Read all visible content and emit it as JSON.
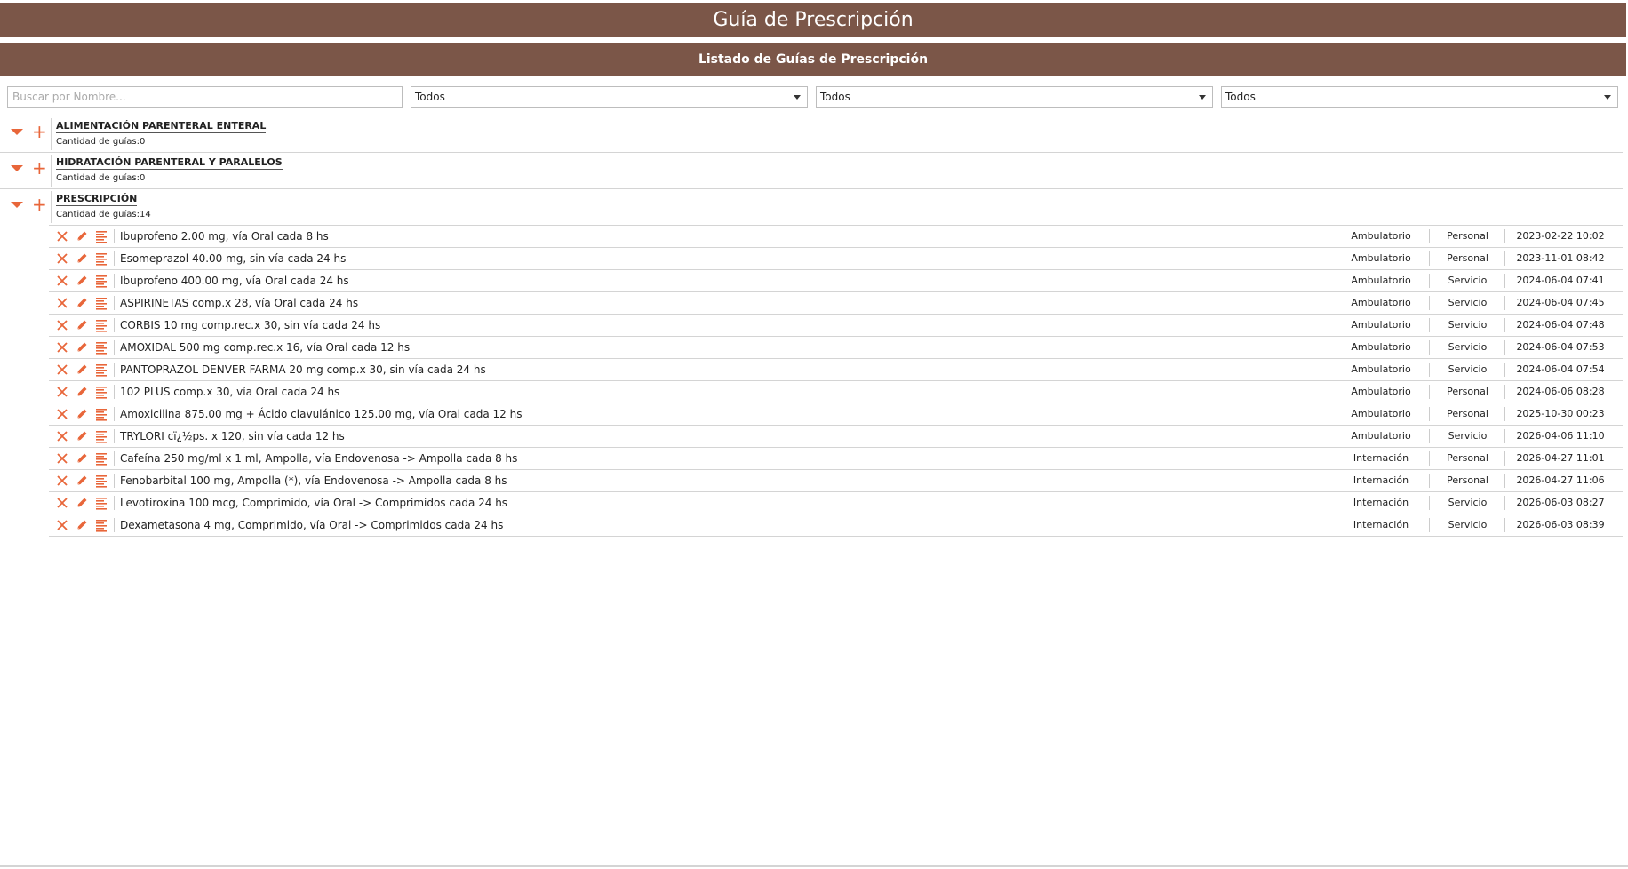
{
  "app": {
    "title": "Guía de Prescripción",
    "subtitle": "Listado de Guías de Prescripción"
  },
  "filters": {
    "search_placeholder": "Buscar por Nombre...",
    "select1": "Todos",
    "select2": "Todos",
    "select3": "Todos"
  },
  "groups": [
    {
      "name": "ALIMENTACIÓN PARENTERAL ENTERAL",
      "count": "Cantidad de guías:0"
    },
    {
      "name": "HIDRATACIÓN PARENTERAL Y PARALELOS",
      "count": "Cantidad de guías:0"
    },
    {
      "name": "PRESCRIPCIÓN",
      "count": "Cantidad de guías:14"
    }
  ],
  "rows": [
    {
      "text": "Ibuprofeno 2.00 mg, vía Oral cada 8 hs",
      "type": "Ambulatorio",
      "owner": "Personal",
      "date": "2023-02-22 10:02"
    },
    {
      "text": "Esomeprazol 40.00 mg, sin vía cada 24 hs",
      "type": "Ambulatorio",
      "owner": "Personal",
      "date": "2023-11-01 08:42"
    },
    {
      "text": "Ibuprofeno 400.00 mg, vía Oral cada 24 hs",
      "type": "Ambulatorio",
      "owner": "Servicio",
      "date": "2024-06-04 07:41"
    },
    {
      "text": "ASPIRINETAS comp.x 28, vía Oral cada 24 hs",
      "type": "Ambulatorio",
      "owner": "Servicio",
      "date": "2024-06-04 07:45"
    },
    {
      "text": "CORBIS 10 mg comp.rec.x 30, sin vía cada 24 hs",
      "type": "Ambulatorio",
      "owner": "Servicio",
      "date": "2024-06-04 07:48"
    },
    {
      "text": "AMOXIDAL 500 mg comp.rec.x 16, vía Oral cada 12 hs",
      "type": "Ambulatorio",
      "owner": "Servicio",
      "date": "2024-06-04 07:53"
    },
    {
      "text": "PANTOPRAZOL DENVER FARMA 20 mg comp.x 30, sin vía cada 24 hs",
      "type": "Ambulatorio",
      "owner": "Servicio",
      "date": "2024-06-04 07:54"
    },
    {
      "text": "102 PLUS comp.x 30, vía Oral cada 24 hs",
      "type": "Ambulatorio",
      "owner": "Personal",
      "date": "2024-06-06 08:28"
    },
    {
      "text": "Amoxicilina 875.00 mg + Ácido clavulánico 125.00 mg, vía Oral cada 12 hs",
      "type": "Ambulatorio",
      "owner": "Personal",
      "date": "2025-10-30 00:23"
    },
    {
      "text": "TRYLORI cï¿½ps. x 120, sin vía cada 12 hs",
      "type": "Ambulatorio",
      "owner": "Servicio",
      "date": "2026-04-06 11:10"
    },
    {
      "text": "Cafeína 250 mg/ml x 1 ml, Ampolla, vía Endovenosa -> Ampolla cada 8 hs",
      "type": "Internación",
      "owner": "Personal",
      "date": "2026-04-27 11:01"
    },
    {
      "text": "Fenobarbital 100 mg, Ampolla (*), vía Endovenosa -> Ampolla cada 8 hs",
      "type": "Internación",
      "owner": "Personal",
      "date": "2026-04-27 11:06"
    },
    {
      "text": "Levotiroxina 100 mcg, Comprimido, vía Oral -> Comprimidos cada 24 hs",
      "type": "Internación",
      "owner": "Servicio",
      "date": "2026-06-03 08:27"
    },
    {
      "text": "Dexametasona 4 mg, Comprimido, vía Oral -> Comprimidos cada 24 hs",
      "type": "Internación",
      "owner": "Servicio",
      "date": "2026-06-03 08:39"
    }
  ],
  "colors": {
    "header_bg": "#7b5648",
    "accent": "#e8663a"
  },
  "icons": {
    "collapse": "caret-down-icon",
    "add": "plus-icon",
    "delete": "close-icon",
    "edit": "pencil-icon",
    "detail": "lines-icon"
  }
}
